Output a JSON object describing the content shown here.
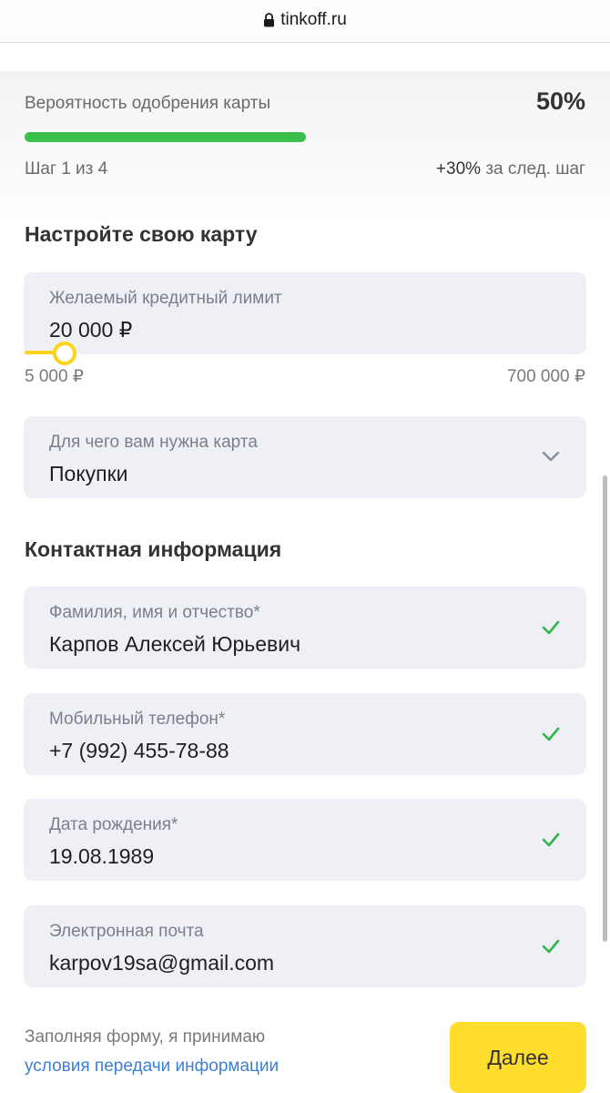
{
  "browser": {
    "url": "tinkoff.ru"
  },
  "approval": {
    "label": "Вероятность одобрения карты",
    "value": "50%",
    "progress_fraction": 0.5,
    "step_text": "Шаг 1 из 4",
    "bonus_value": "+30%",
    "bonus_suffix": "за след. шаг"
  },
  "card_setup": {
    "title": "Настройте свою карту",
    "limit": {
      "label": "Желаемый кредитный лимит",
      "value": "20 000 ₽",
      "min_label": "5 000 ₽",
      "max_label": "700 000 ₽"
    },
    "purpose": {
      "label": "Для чего вам нужна карта",
      "value": "Покупки"
    }
  },
  "contact": {
    "title": "Контактная информация",
    "fields": [
      {
        "label": "Фамилия, имя и отчество*",
        "value": "Карпов Алексей Юрьевич"
      },
      {
        "label": "Мобильный телефон*",
        "value": "+7 (992) 455-78-88"
      },
      {
        "label": "Дата рождения*",
        "value": "19.08.1989"
      },
      {
        "label": "Электронная почта",
        "value": "karpov19sa@gmail.com"
      }
    ]
  },
  "footer": {
    "consent_text": "Заполняя форму, я принимаю",
    "consent_link": "условия передачи информации",
    "next_button": "Далее"
  },
  "colors": {
    "accent": "#ffdd2d",
    "progress": "#3ac04a",
    "check": "#2fb54a",
    "link": "#3d7fd6",
    "field_bg": "#eef0f6"
  },
  "icons": {
    "lock": "lock-icon",
    "check": "check-icon",
    "dropdown": "chevron-down-icon"
  }
}
